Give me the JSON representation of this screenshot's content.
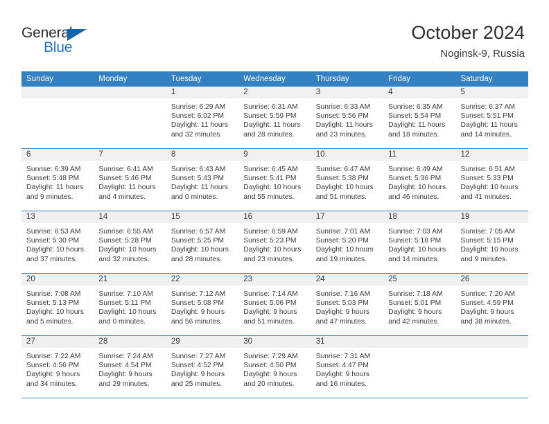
{
  "logo": {
    "word_top": "General",
    "word_bottom": "Blue",
    "triangle_icon": "triangle-icon",
    "accent_color": "#1464aa"
  },
  "header": {
    "title": "October 2024",
    "subtitle": "Noginsk-9, Russia"
  },
  "calendar": {
    "header_color": "#3380c2",
    "weekday_headers": [
      "Sunday",
      "Monday",
      "Tuesday",
      "Wednesday",
      "Thursday",
      "Friday",
      "Saturday"
    ],
    "weeks": [
      [
        {
          "day": "",
          "empty": true,
          "sunrise": "",
          "sunset": "",
          "daylight_1": "",
          "daylight_2": ""
        },
        {
          "day": "",
          "empty": true,
          "sunrise": "",
          "sunset": "",
          "daylight_1": "",
          "daylight_2": ""
        },
        {
          "day": "1",
          "sunrise": "Sunrise: 6:29 AM",
          "sunset": "Sunset: 6:02 PM",
          "daylight_1": "Daylight: 11 hours",
          "daylight_2": "and 32 minutes."
        },
        {
          "day": "2",
          "sunrise": "Sunrise: 6:31 AM",
          "sunset": "Sunset: 5:59 PM",
          "daylight_1": "Daylight: 11 hours",
          "daylight_2": "and 28 minutes."
        },
        {
          "day": "3",
          "sunrise": "Sunrise: 6:33 AM",
          "sunset": "Sunset: 5:56 PM",
          "daylight_1": "Daylight: 11 hours",
          "daylight_2": "and 23 minutes."
        },
        {
          "day": "4",
          "sunrise": "Sunrise: 6:35 AM",
          "sunset": "Sunset: 5:54 PM",
          "daylight_1": "Daylight: 11 hours",
          "daylight_2": "and 18 minutes."
        },
        {
          "day": "5",
          "sunrise": "Sunrise: 6:37 AM",
          "sunset": "Sunset: 5:51 PM",
          "daylight_1": "Daylight: 11 hours",
          "daylight_2": "and 14 minutes."
        }
      ],
      [
        {
          "day": "6",
          "sunrise": "Sunrise: 6:39 AM",
          "sunset": "Sunset: 5:48 PM",
          "daylight_1": "Daylight: 11 hours",
          "daylight_2": "and 9 minutes."
        },
        {
          "day": "7",
          "sunrise": "Sunrise: 6:41 AM",
          "sunset": "Sunset: 5:46 PM",
          "daylight_1": "Daylight: 11 hours",
          "daylight_2": "and 4 minutes."
        },
        {
          "day": "8",
          "sunrise": "Sunrise: 6:43 AM",
          "sunset": "Sunset: 5:43 PM",
          "daylight_1": "Daylight: 11 hours",
          "daylight_2": "and 0 minutes."
        },
        {
          "day": "9",
          "sunrise": "Sunrise: 6:45 AM",
          "sunset": "Sunset: 5:41 PM",
          "daylight_1": "Daylight: 10 hours",
          "daylight_2": "and 55 minutes."
        },
        {
          "day": "10",
          "sunrise": "Sunrise: 6:47 AM",
          "sunset": "Sunset: 5:38 PM",
          "daylight_1": "Daylight: 10 hours",
          "daylight_2": "and 51 minutes."
        },
        {
          "day": "11",
          "sunrise": "Sunrise: 6:49 AM",
          "sunset": "Sunset: 5:36 PM",
          "daylight_1": "Daylight: 10 hours",
          "daylight_2": "and 46 minutes."
        },
        {
          "day": "12",
          "sunrise": "Sunrise: 6:51 AM",
          "sunset": "Sunset: 5:33 PM",
          "daylight_1": "Daylight: 10 hours",
          "daylight_2": "and 41 minutes."
        }
      ],
      [
        {
          "day": "13",
          "sunrise": "Sunrise: 6:53 AM",
          "sunset": "Sunset: 5:30 PM",
          "daylight_1": "Daylight: 10 hours",
          "daylight_2": "and 37 minutes."
        },
        {
          "day": "14",
          "sunrise": "Sunrise: 6:55 AM",
          "sunset": "Sunset: 5:28 PM",
          "daylight_1": "Daylight: 10 hours",
          "daylight_2": "and 32 minutes."
        },
        {
          "day": "15",
          "sunrise": "Sunrise: 6:57 AM",
          "sunset": "Sunset: 5:25 PM",
          "daylight_1": "Daylight: 10 hours",
          "daylight_2": "and 28 minutes."
        },
        {
          "day": "16",
          "sunrise": "Sunrise: 6:59 AM",
          "sunset": "Sunset: 5:23 PM",
          "daylight_1": "Daylight: 10 hours",
          "daylight_2": "and 23 minutes."
        },
        {
          "day": "17",
          "sunrise": "Sunrise: 7:01 AM",
          "sunset": "Sunset: 5:20 PM",
          "daylight_1": "Daylight: 10 hours",
          "daylight_2": "and 19 minutes."
        },
        {
          "day": "18",
          "sunrise": "Sunrise: 7:03 AM",
          "sunset": "Sunset: 5:18 PM",
          "daylight_1": "Daylight: 10 hours",
          "daylight_2": "and 14 minutes."
        },
        {
          "day": "19",
          "sunrise": "Sunrise: 7:05 AM",
          "sunset": "Sunset: 5:15 PM",
          "daylight_1": "Daylight: 10 hours",
          "daylight_2": "and 9 minutes."
        }
      ],
      [
        {
          "day": "20",
          "sunrise": "Sunrise: 7:08 AM",
          "sunset": "Sunset: 5:13 PM",
          "daylight_1": "Daylight: 10 hours",
          "daylight_2": "and 5 minutes."
        },
        {
          "day": "21",
          "sunrise": "Sunrise: 7:10 AM",
          "sunset": "Sunset: 5:11 PM",
          "daylight_1": "Daylight: 10 hours",
          "daylight_2": "and 0 minutes."
        },
        {
          "day": "22",
          "sunrise": "Sunrise: 7:12 AM",
          "sunset": "Sunset: 5:08 PM",
          "daylight_1": "Daylight: 9 hours",
          "daylight_2": "and 56 minutes."
        },
        {
          "day": "23",
          "sunrise": "Sunrise: 7:14 AM",
          "sunset": "Sunset: 5:06 PM",
          "daylight_1": "Daylight: 9 hours",
          "daylight_2": "and 51 minutes."
        },
        {
          "day": "24",
          "sunrise": "Sunrise: 7:16 AM",
          "sunset": "Sunset: 5:03 PM",
          "daylight_1": "Daylight: 9 hours",
          "daylight_2": "and 47 minutes."
        },
        {
          "day": "25",
          "sunrise": "Sunrise: 7:18 AM",
          "sunset": "Sunset: 5:01 PM",
          "daylight_1": "Daylight: 9 hours",
          "daylight_2": "and 42 minutes."
        },
        {
          "day": "26",
          "sunrise": "Sunrise: 7:20 AM",
          "sunset": "Sunset: 4:59 PM",
          "daylight_1": "Daylight: 9 hours",
          "daylight_2": "and 38 minutes."
        }
      ],
      [
        {
          "day": "27",
          "sunrise": "Sunrise: 7:22 AM",
          "sunset": "Sunset: 4:56 PM",
          "daylight_1": "Daylight: 9 hours",
          "daylight_2": "and 34 minutes."
        },
        {
          "day": "28",
          "sunrise": "Sunrise: 7:24 AM",
          "sunset": "Sunset: 4:54 PM",
          "daylight_1": "Daylight: 9 hours",
          "daylight_2": "and 29 minutes."
        },
        {
          "day": "29",
          "sunrise": "Sunrise: 7:27 AM",
          "sunset": "Sunset: 4:52 PM",
          "daylight_1": "Daylight: 9 hours",
          "daylight_2": "and 25 minutes."
        },
        {
          "day": "30",
          "sunrise": "Sunrise: 7:29 AM",
          "sunset": "Sunset: 4:50 PM",
          "daylight_1": "Daylight: 9 hours",
          "daylight_2": "and 20 minutes."
        },
        {
          "day": "31",
          "sunrise": "Sunrise: 7:31 AM",
          "sunset": "Sunset: 4:47 PM",
          "daylight_1": "Daylight: 9 hours",
          "daylight_2": "and 16 minutes."
        },
        {
          "day": "",
          "empty": true,
          "sunrise": "",
          "sunset": "",
          "daylight_1": "",
          "daylight_2": ""
        },
        {
          "day": "",
          "empty": true,
          "sunrise": "",
          "sunset": "",
          "daylight_1": "",
          "daylight_2": ""
        }
      ]
    ]
  }
}
